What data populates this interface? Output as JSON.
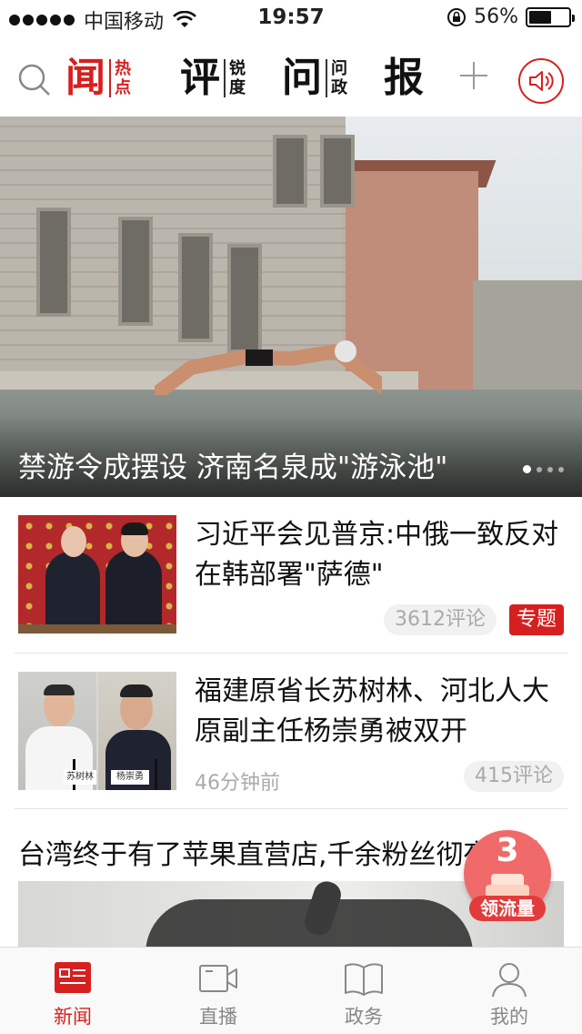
{
  "status_bar": {
    "carrier": "中国移动",
    "time": "19:57",
    "battery": "56%",
    "battery_level": 0.56
  },
  "channels": [
    {
      "big": "闻",
      "sub": [
        "热",
        "点"
      ],
      "active": true
    },
    {
      "big": "评",
      "sub": [
        "锐",
        "度"
      ],
      "active": false
    },
    {
      "big": "问",
      "sub": [
        "问",
        "政"
      ],
      "active": false
    },
    {
      "big": "报",
      "sub": [],
      "active": false
    }
  ],
  "hero": {
    "caption": "禁游令成摆设 济南名泉成\"游泳池\"",
    "pages": 4,
    "current_page": 1
  },
  "news": [
    {
      "title": "习近平会见普京:中俄一致反对在韩部署\"萨德\"",
      "comments": "3612评论",
      "tag": "专题"
    },
    {
      "title": "福建原省长苏树林、河北人大原副主任杨崇勇被双开",
      "time": "46分钟前",
      "comments": "415评论",
      "sign_left": "苏树林",
      "sign_right": "杨崇勇"
    },
    {
      "title": "台湾终于有了苹果直营店,千余粉丝彻夜排队"
    }
  ],
  "promo": {
    "number": "3",
    "label": "领流量"
  },
  "tabbar": [
    {
      "label": "新闻",
      "icon": "news-icon",
      "active": true
    },
    {
      "label": "直播",
      "icon": "video-icon",
      "active": false
    },
    {
      "label": "政务",
      "icon": "book-icon",
      "active": false
    },
    {
      "label": "我的",
      "icon": "user-icon",
      "active": false
    }
  ],
  "colors": {
    "accent": "#d6201f",
    "inactive": "#888888"
  }
}
